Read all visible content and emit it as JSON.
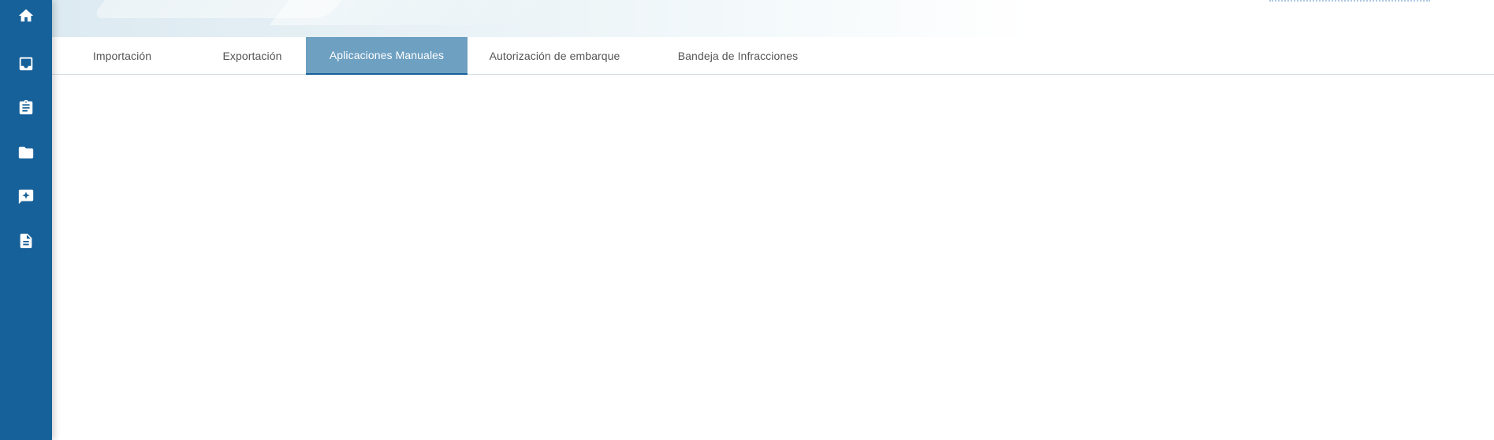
{
  "sidebar": {
    "items": [
      {
        "icon": "home-icon"
      },
      {
        "icon": "inbox-icon"
      },
      {
        "icon": "clipboard-icon"
      },
      {
        "icon": "folder-icon"
      },
      {
        "icon": "feedback-icon"
      },
      {
        "icon": "document-icon"
      }
    ]
  },
  "tabs": [
    {
      "label": "Importación",
      "active": false
    },
    {
      "label": "Exportación",
      "active": false
    },
    {
      "label": "Aplicaciones Manuales",
      "active": true
    },
    {
      "label": "Autorización de embarque",
      "active": false
    },
    {
      "label": "Bandeja de Infracciones",
      "active": false
    }
  ],
  "colors": {
    "sidebar": "#17619a",
    "active_tab": "#6ea0c2",
    "tab_text": "#555555"
  }
}
